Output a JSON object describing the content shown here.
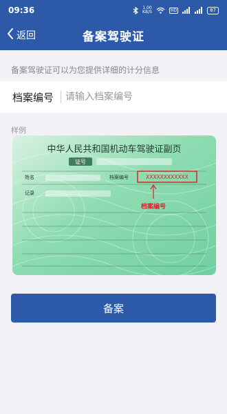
{
  "status": {
    "time": "09:36",
    "speed": "1.00\nKB/S",
    "net1": "4G",
    "net2": "HD",
    "battery": "87"
  },
  "nav": {
    "back_label": "返回",
    "title": "备案驾驶证"
  },
  "form": {
    "hint": "备案驾驶证可以为您提供详细的计分信息",
    "file_number_label": "档案编号",
    "file_number_placeholder": "请输入档案编号",
    "file_number_value": ""
  },
  "sample": {
    "label": "样例",
    "card_title": "中华人民共和国机动车驾驶证副页",
    "license_no_label": "证号",
    "name_label": "姓名",
    "file_no_label": "档案编号",
    "file_no_mask": "XXXXXXXXXXXX",
    "record_label": "记录",
    "annotation": "档案编号"
  },
  "actions": {
    "submit_label": "备案"
  },
  "colors": {
    "primary": "#2c5aa8",
    "annotation_red": "#e0202a",
    "card_green": "#7fd1a6"
  }
}
